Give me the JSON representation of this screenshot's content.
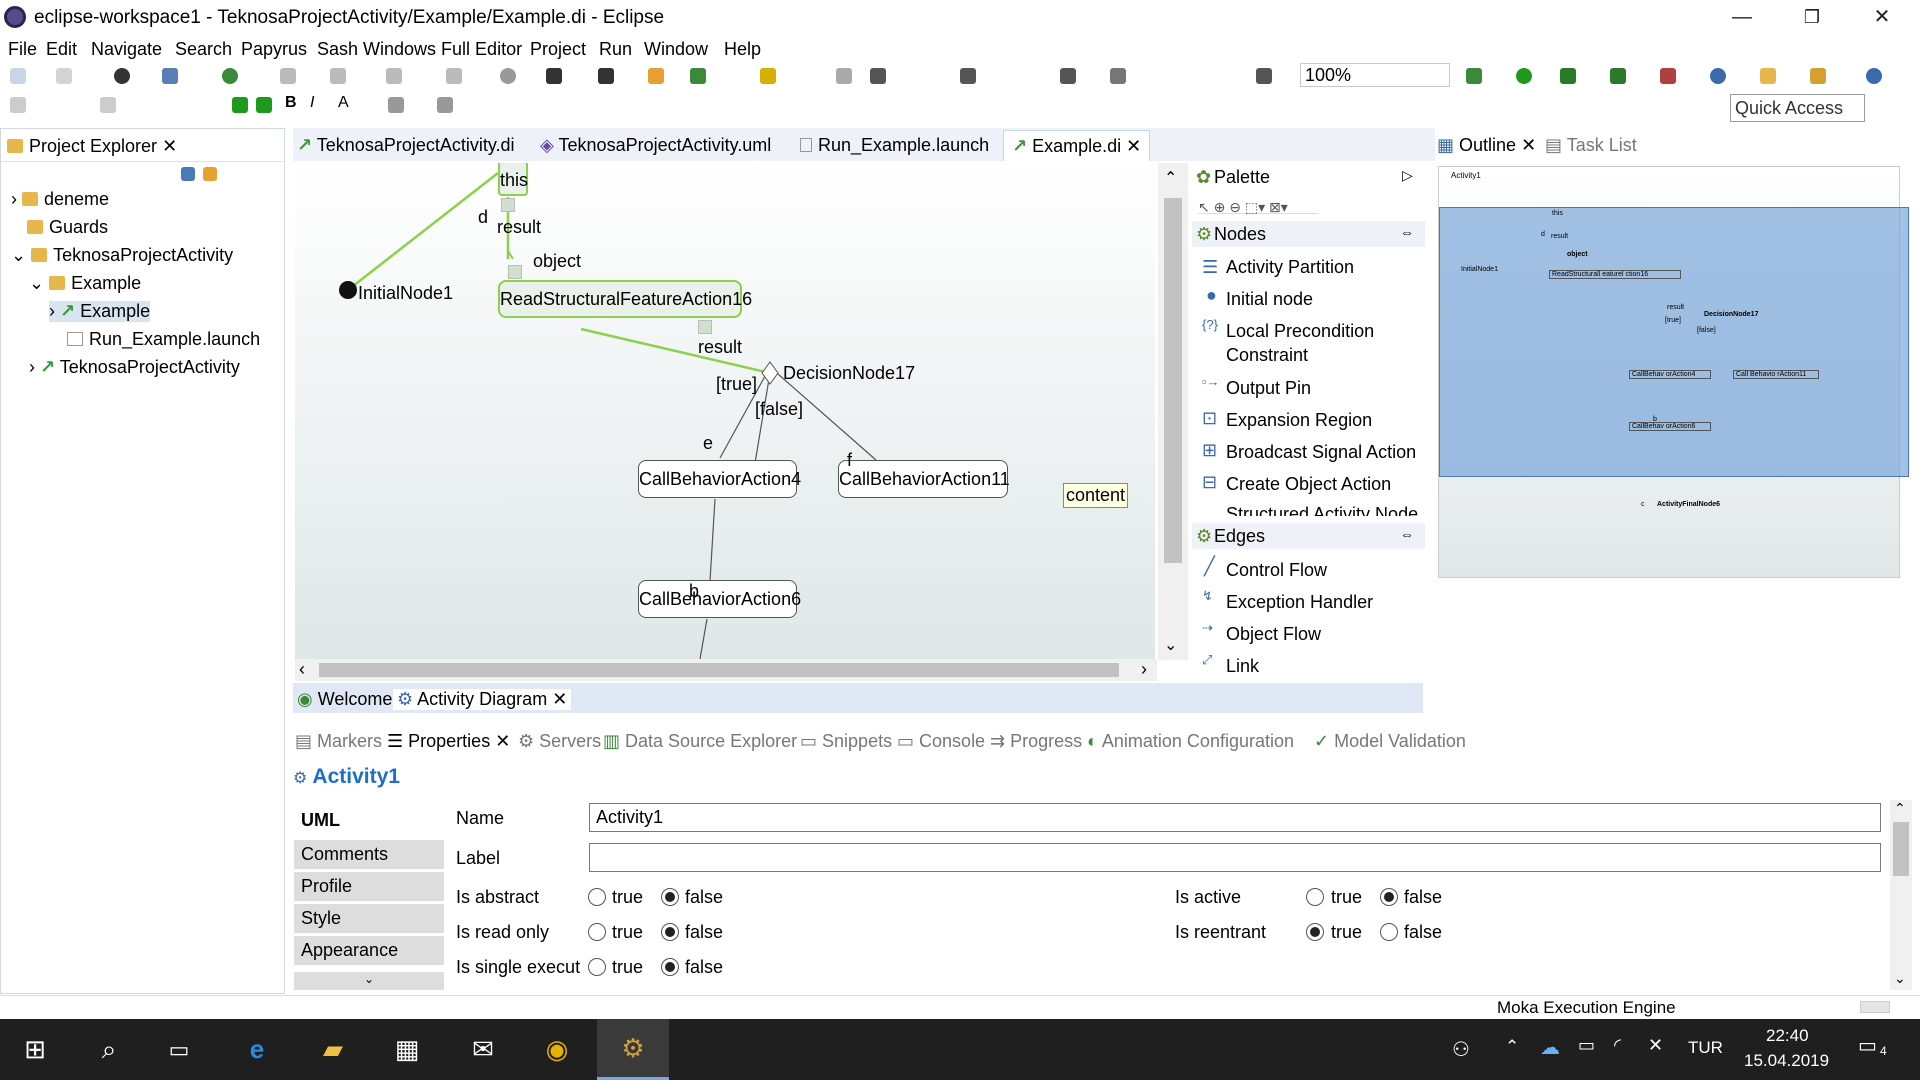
{
  "window": {
    "title": "eclipse-workspace1 - TeknosaProjectActivity/Example/Example.di - Eclipse",
    "min": "—",
    "max": "❐",
    "close": "✕"
  },
  "menu": [
    "File",
    "Edit",
    "Navigate",
    "Search",
    "Papyrus",
    "Sash Windows Full Editor",
    "Project",
    "Run",
    "Window",
    "Help"
  ],
  "toolbar": {
    "zoom": "100%",
    "quick_access": "Quick Access"
  },
  "project_explorer": {
    "title": "Project Explorer",
    "items": [
      {
        "label": "deneme",
        "icon": "project-icon"
      },
      {
        "label": "Guards",
        "icon": "folder-icon"
      },
      {
        "label": "TeknosaProjectActivity",
        "icon": "project-icon"
      },
      {
        "label": "Example",
        "icon": "folder-icon"
      },
      {
        "label": "Example",
        "icon": "papyrus-model-icon"
      },
      {
        "label": "Run_Example.launch",
        "icon": "launch-file-icon"
      },
      {
        "label": "TeknosaProjectActivity",
        "icon": "papyrus-model-icon"
      }
    ]
  },
  "editor_tabs": [
    "TeknosaProjectActivity.di",
    "TeknosaProjectActivity.uml",
    "Run_Example.launch",
    "Example.di"
  ],
  "diagram": {
    "nodes": {
      "this": "this",
      "initial": "InitialNode1",
      "read": "ReadStructuralFeatureAction16",
      "decision": "DecisionNode17",
      "cba4": "CallBehaviorAction4",
      "cba11": "CallBehaviorAction11",
      "cba6": "CallBehaviorAction6",
      "content": "content"
    },
    "labels": {
      "d": "d",
      "result1": "result",
      "object": "object",
      "result2": "result",
      "true": "[true]",
      "false": "[false]",
      "e": "e",
      "f": "f",
      "b": "b"
    }
  },
  "palette": {
    "title": "Palette",
    "nodes_header": "Nodes",
    "nodes": [
      "Activity Partition",
      "Initial node",
      "Local Precondition",
      "Constraint",
      "Output Pin",
      "Expansion Region",
      "Broadcast Signal Action",
      "Create Object Action",
      "Structured Activity Node"
    ],
    "edges_header": "Edges",
    "edges": [
      "Control Flow",
      "Exception Handler",
      "Object Flow",
      "Link"
    ]
  },
  "diagram_tabs": [
    "Welcome",
    "Activity Diagram"
  ],
  "outline": {
    "tabs": [
      "Outline",
      "Task List"
    ],
    "mini_labels": {
      "activity": "Activity1",
      "this": "this",
      "d": "d",
      "result": "result",
      "object": "object",
      "initial": "InitialNode1",
      "read": "ReadStructurall eaturel ction16",
      "result2": "result",
      "decision": "DecisionNode17",
      "true": "[true]",
      "false": "[false]",
      "cba4": "CallBehav orAction4",
      "cba11": "Call Behavio rAction11",
      "b": "b",
      "cba6": "CallBehav orAction6",
      "c": "c",
      "final": "ActivityFinalNode6"
    }
  },
  "bottom_tabs": [
    "Markers",
    "Properties",
    "Servers",
    "Data Source Explorer",
    "Snippets",
    "Console",
    "Progress",
    "Animation Configuration",
    "Model Validation"
  ],
  "properties": {
    "title": "Activity1",
    "sidetabs": [
      "UML",
      "Comments",
      "Profile",
      "Style",
      "Appearance"
    ],
    "name_label": "Name",
    "name_value": "Activity1",
    "label_label": "Label",
    "label_value": "",
    "is_abstract": "Is abstract",
    "is_read_only": "Is read only",
    "is_single": "Is single execut",
    "is_active": "Is active",
    "is_reentrant": "Is reentrant",
    "true": "true",
    "false": "false"
  },
  "status": {
    "engine": "Moka Execution Engine"
  },
  "taskbar": {
    "lang": "TUR",
    "time": "22:40",
    "date": "15.04.2019",
    "notifications": "4"
  }
}
